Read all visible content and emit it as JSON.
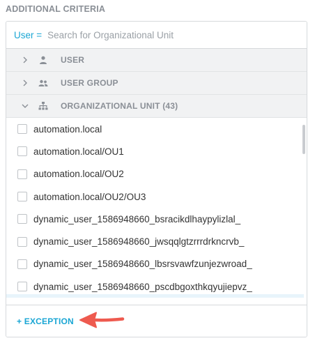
{
  "section_title": "ADDITIONAL CRITERIA",
  "search": {
    "prefix": "User =",
    "placeholder": "Search for Organizational Unit",
    "value": ""
  },
  "groups": [
    {
      "label": "USER",
      "icon": "user-icon",
      "expanded": false
    },
    {
      "label": "USER GROUP",
      "icon": "user-group-icon",
      "expanded": false
    },
    {
      "label": "ORGANIZATIONAL UNIT (43)",
      "icon": "org-unit-icon",
      "expanded": true
    }
  ],
  "items": [
    {
      "label": "automation.local",
      "checked": false
    },
    {
      "label": "automation.local/OU1",
      "checked": false
    },
    {
      "label": "automation.local/OU2",
      "checked": false
    },
    {
      "label": "automation.local/OU2/OU3",
      "checked": false
    },
    {
      "label": "dynamic_user_1586948660_bsracikdlhaypylizlal_",
      "checked": false
    },
    {
      "label": "dynamic_user_1586948660_jwsqqlgtzrrrdrkncrvb_",
      "checked": false
    },
    {
      "label": "dynamic_user_1586948660_lbsrsvawfzunjezwroad_",
      "checked": false
    },
    {
      "label": "dynamic_user_1586948660_pscdbgoxthkqyujiepvz_",
      "checked": false
    }
  ],
  "footer": {
    "exception_label": "+ EXCEPTION"
  },
  "colors": {
    "accent": "#1aa6d4",
    "annotation_arrow": "#ee5a4f",
    "group_bg": "#f1f2f3"
  }
}
